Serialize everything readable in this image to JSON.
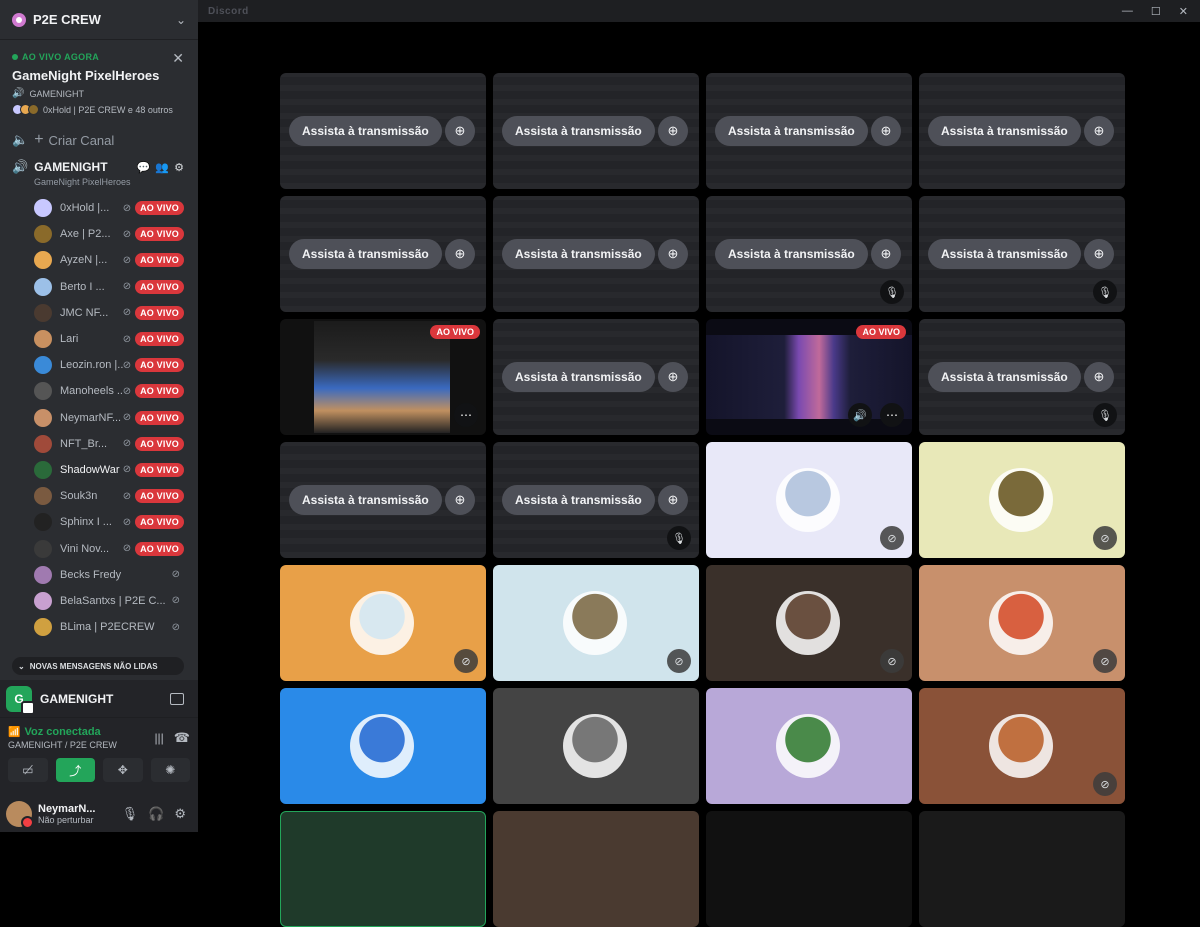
{
  "server": {
    "name": "P2E CREW"
  },
  "event": {
    "live_label": "AO VIVO AGORA",
    "title": "GameNight PixelHeroes",
    "channel": "GAMENIGHT",
    "people_text": "0xHold | P2E CREW e 48 outros"
  },
  "sidebar": {
    "create_channel": "Criar Canal",
    "voice_channel": {
      "name": "GAMENIGHT",
      "subtitle": "GameNight PixelHeroes"
    },
    "members": [
      {
        "name": "0xHold |...",
        "live": "AO VIVO",
        "color": "#c8c8ff"
      },
      {
        "name": "Axe | P2...",
        "live": "AO VIVO",
        "color": "#8a6a2a"
      },
      {
        "name": "AyzeN |...",
        "live": "AO VIVO",
        "color": "#e8a850"
      },
      {
        "name": "Berto I ...",
        "live": "AO VIVO",
        "color": "#9cc0e8"
      },
      {
        "name": "JMC NF...",
        "live": "AO VIVO",
        "color": "#4a3a30"
      },
      {
        "name": "Lari",
        "live": "AO VIVO",
        "color": "#c89060"
      },
      {
        "name": "Leozin.ron |...",
        "live": "AO VIVO",
        "color": "#3a8ad8"
      },
      {
        "name": "Manoheels ...",
        "live": "AO VIVO",
        "color": "#555555"
      },
      {
        "name": "NeymarNF...",
        "live": "AO VIVO",
        "color": "#c89068"
      },
      {
        "name": "NFT_Br...",
        "live": "AO VIVO",
        "color": "#a04a3a"
      },
      {
        "name": "ShadowWar",
        "live": "AO VIVO",
        "color": "#2a6a3a"
      },
      {
        "name": "Souk3n",
        "live": "AO VIVO",
        "color": "#7a5a40"
      },
      {
        "name": "Sphinx I ...",
        "live": "AO VIVO",
        "color": "#222222"
      },
      {
        "name": "Vini Nov...",
        "live": "AO VIVO",
        "color": "#3a3a3a"
      },
      {
        "name": "Becks Fredy",
        "live": "",
        "color": "#a07ab0"
      },
      {
        "name": "BelaSantxs | P2E C...",
        "live": "",
        "color": "#c8a0d0"
      },
      {
        "name": "BLima | P2ECREW",
        "live": "",
        "color": "#d0a040"
      }
    ],
    "unread": "NOVAS MENSAGENS NÃO LIDAS"
  },
  "panel": {
    "app_name": "GAMENIGHT",
    "voice_status": "Voz conectada",
    "voice_sub": "GAMENIGHT / P2E CREW"
  },
  "user": {
    "name": "NeymarN...",
    "status": "Não perturbar"
  },
  "window": {
    "title": "Discord"
  },
  "stream": {
    "watch_label": "Assista à transmissão",
    "live_tag": "AO VIVO"
  },
  "colors": {
    "live_red": "#da373c",
    "green": "#23a55a",
    "pill": "#4e5058"
  }
}
